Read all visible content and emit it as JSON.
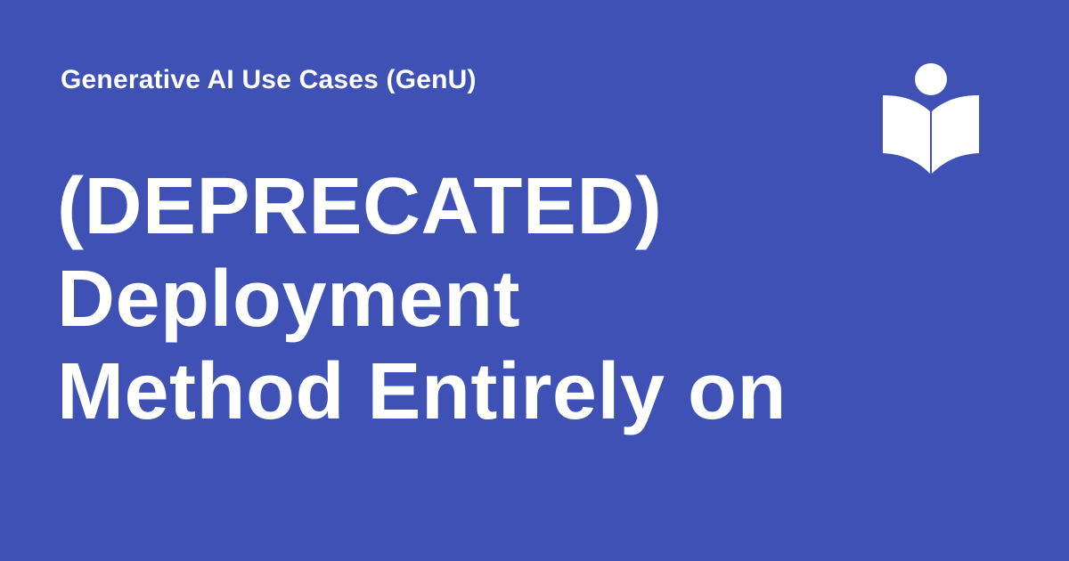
{
  "site": {
    "name": "Generative AI Use Cases (GenU)"
  },
  "page": {
    "title_lines": [
      "(DEPRECATED)",
      "Deployment",
      "Method Entirely on"
    ]
  },
  "logo": {
    "icon": "reader-book-icon"
  },
  "colors": {
    "background": "#3f51b5",
    "foreground": "#ffffff"
  }
}
